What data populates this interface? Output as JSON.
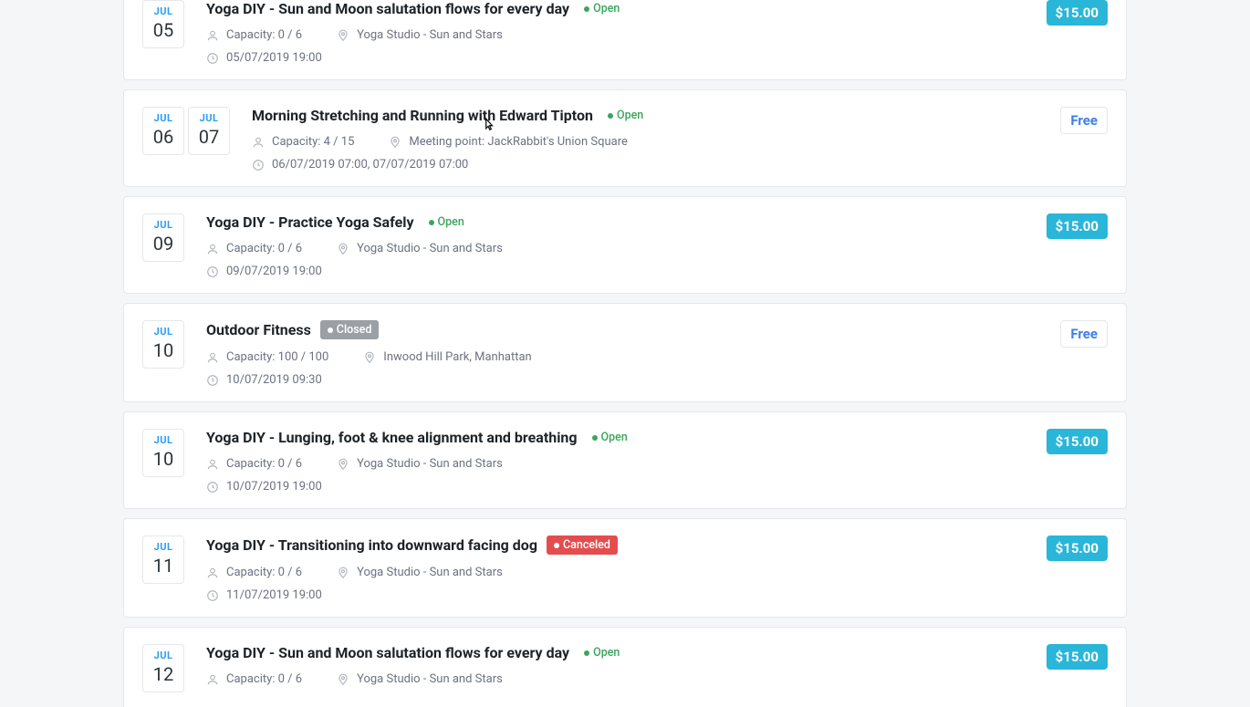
{
  "events": [
    {
      "dates": [
        {
          "month": "JUL",
          "day": "05"
        }
      ],
      "title": "Yoga DIY - Sun and Moon salutation flows for every day",
      "status": {
        "label": "Open",
        "kind": "open"
      },
      "capacity": "Capacity: 0 / 6",
      "location": "Yoga Studio - Sun and Stars",
      "datetime": "05/07/2019 19:00",
      "price": {
        "label": "$15.00",
        "kind": "paid"
      },
      "first": true
    },
    {
      "dates": [
        {
          "month": "JUL",
          "day": "06"
        },
        {
          "month": "JUL",
          "day": "07"
        }
      ],
      "title": "Morning Stretching and Running with Edward Tipton",
      "status": {
        "label": "Open",
        "kind": "open"
      },
      "capacity": "Capacity: 4 / 15",
      "location": "Meeting point: JackRabbit's Union Square",
      "datetime": "06/07/2019 07:00, 07/07/2019 07:00",
      "price": {
        "label": "Free",
        "kind": "free"
      },
      "cursor": true
    },
    {
      "dates": [
        {
          "month": "JUL",
          "day": "09"
        }
      ],
      "title": "Yoga DIY - Practice Yoga Safely",
      "status": {
        "label": "Open",
        "kind": "open"
      },
      "capacity": "Capacity: 0 / 6",
      "location": "Yoga Studio - Sun and Stars",
      "datetime": "09/07/2019 19:00",
      "price": {
        "label": "$15.00",
        "kind": "paid"
      }
    },
    {
      "dates": [
        {
          "month": "JUL",
          "day": "10"
        }
      ],
      "title": "Outdoor Fitness",
      "status": {
        "label": "Closed",
        "kind": "closed"
      },
      "capacity": "Capacity: 100 / 100",
      "location": "Inwood Hill Park, Manhattan",
      "datetime": "10/07/2019 09:30",
      "price": {
        "label": "Free",
        "kind": "free"
      }
    },
    {
      "dates": [
        {
          "month": "JUL",
          "day": "10"
        }
      ],
      "title": "Yoga DIY - Lunging, foot & knee alignment and breathing",
      "status": {
        "label": "Open",
        "kind": "open"
      },
      "capacity": "Capacity: 0 / 6",
      "location": "Yoga Studio - Sun and Stars",
      "datetime": "10/07/2019 19:00",
      "price": {
        "label": "$15.00",
        "kind": "paid"
      }
    },
    {
      "dates": [
        {
          "month": "JUL",
          "day": "11"
        }
      ],
      "title": "Yoga DIY - Transitioning into downward facing dog",
      "status": {
        "label": "Canceled",
        "kind": "canceled"
      },
      "capacity": "Capacity: 0 / 6",
      "location": "Yoga Studio - Sun and Stars",
      "datetime": "11/07/2019 19:00",
      "price": {
        "label": "$15.00",
        "kind": "paid"
      }
    },
    {
      "dates": [
        {
          "month": "JUL",
          "day": "12"
        }
      ],
      "title": "Yoga DIY - Sun and Moon salutation flows for every day",
      "status": {
        "label": "Open",
        "kind": "open"
      },
      "capacity": "Capacity: 0 / 6",
      "location": "Yoga Studio - Sun and Stars",
      "datetime": "",
      "price": {
        "label": "$15.00",
        "kind": "paid"
      },
      "last": true
    }
  ]
}
